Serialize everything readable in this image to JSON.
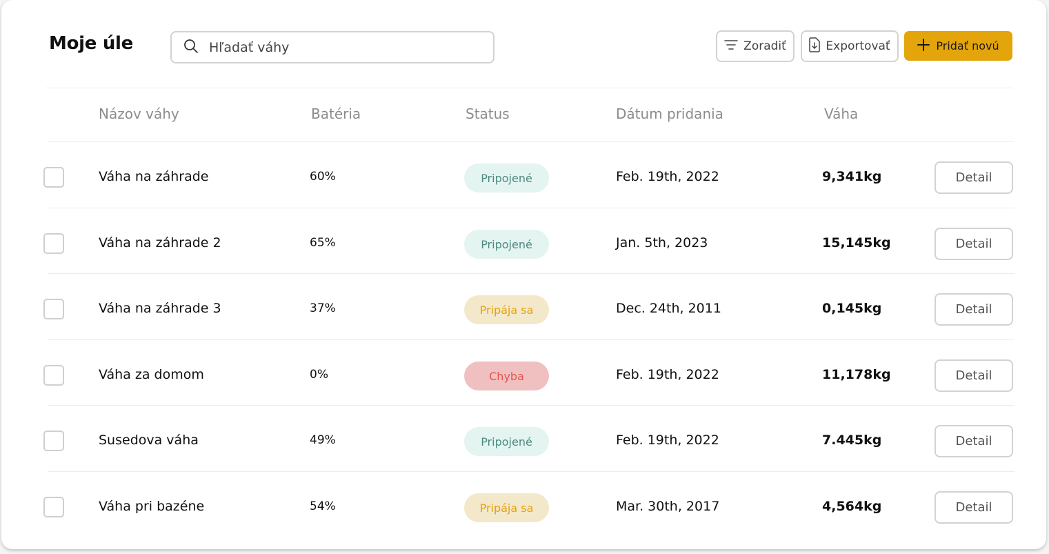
{
  "header": {
    "title": "Moje úle",
    "search_placeholder": "Hľadať váhy",
    "sort_label": "Zoradiť",
    "export_label": "Exportovať",
    "add_label": "Pridať novú"
  },
  "table": {
    "columns": [
      "Názov váhy",
      "Batéria",
      "Status",
      "Dátum pridania",
      "Váha"
    ],
    "detail_label": "Detail",
    "rows": [
      {
        "name": "Váha na záhrade",
        "battery": "60%",
        "status": "Pripojené",
        "status_kind": "connected",
        "date": "Feb. 19th, 2022",
        "weight": "9,341kg"
      },
      {
        "name": "Váha na záhrade 2",
        "battery": "65%",
        "status": "Pripojené",
        "status_kind": "connected",
        "date": "Jan. 5th, 2023",
        "weight": "15,145kg"
      },
      {
        "name": "Váha na záhrade 3",
        "battery": "37%",
        "status": "Pripája sa",
        "status_kind": "connecting",
        "date": "Dec. 24th, 2011",
        "weight": "0,145kg"
      },
      {
        "name": "Váha za domom",
        "battery": "0%",
        "status": "Chyba",
        "status_kind": "error",
        "date": "Feb. 19th, 2022",
        "weight": "11,178kg"
      },
      {
        "name": "Susedova váha",
        "battery": "49%",
        "status": "Pripojené",
        "status_kind": "connected",
        "date": "Feb. 19th, 2022",
        "weight": "7.445kg"
      },
      {
        "name": "Váha pri bazéne",
        "battery": "54%",
        "status": "Pripája sa",
        "status_kind": "connecting",
        "date": "Mar. 30th, 2017",
        "weight": "4,564kg"
      }
    ]
  },
  "status_colors": {
    "connected": {
      "bg": "#e3f4f1",
      "fg": "#4c8a80"
    },
    "connecting": {
      "bg": "#f4e8ca",
      "fg": "#e2a20c"
    },
    "error": {
      "bg": "#f0c0c0",
      "fg": "#e4524f"
    }
  },
  "accent_color": "#e3a50b",
  "icons": {
    "search": "search-icon",
    "sort": "filter-lines-icon",
    "export": "file-download-icon",
    "add": "plus-icon"
  }
}
